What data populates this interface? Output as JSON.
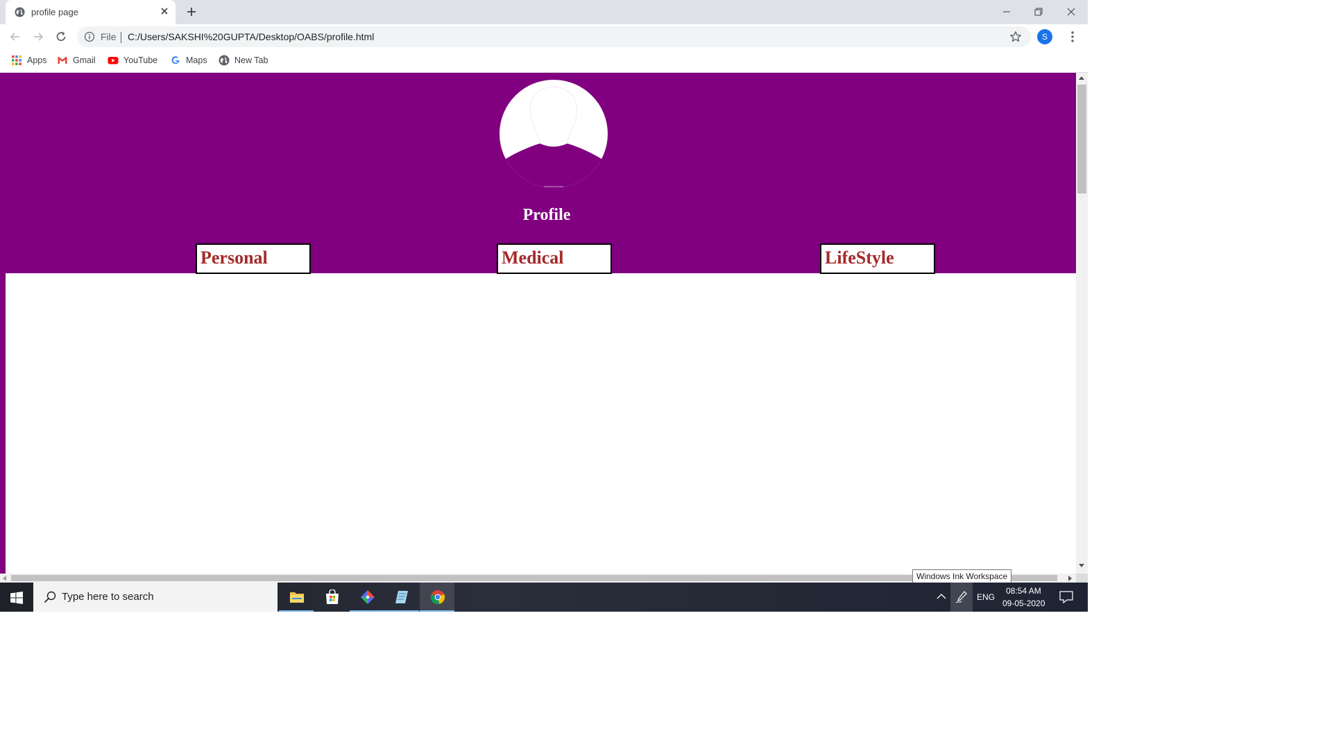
{
  "browser": {
    "tab": {
      "title": "profile page",
      "favicon": "globe-icon"
    },
    "address_bar": {
      "scheme_label": "File",
      "url": "C:/Users/SAKSHI%20GUPTA/Desktop/OABS/profile.html"
    },
    "profile_avatar_letter": "S",
    "bookmarks": [
      {
        "label": "Apps",
        "icon": "apps-grid-icon"
      },
      {
        "label": "Gmail",
        "icon": "gmail-icon"
      },
      {
        "label": "YouTube",
        "icon": "youtube-icon"
      },
      {
        "label": "Maps",
        "icon": "google-icon"
      },
      {
        "label": "New Tab",
        "icon": "globe-icon"
      }
    ]
  },
  "page": {
    "header_color": "#800080",
    "title": "Profile",
    "avatar_icon": "user-silhouette-icon",
    "sections": [
      {
        "label": "Personal",
        "color": "#a52a2a"
      },
      {
        "label": "Medical",
        "color": "#a52a2a"
      },
      {
        "label": "LifeStyle",
        "color": "#a52a2a"
      }
    ]
  },
  "tooltip": "Windows Ink Workspace",
  "taskbar": {
    "search_placeholder": "Type here to search",
    "apps": [
      "file-explorer-icon",
      "microsoft-store-icon",
      "git-icon",
      "notepad-icon",
      "chrome-icon"
    ],
    "language": "ENG",
    "time": "08:54 AM",
    "date": "09-05-2020"
  }
}
